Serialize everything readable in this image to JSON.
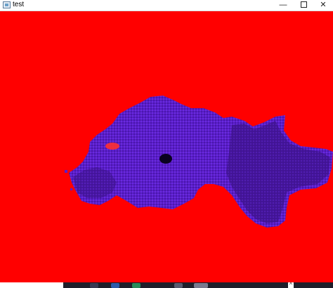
{
  "window": {
    "title": "test",
    "icon": "app-window-icon",
    "controls": {
      "minimize": "—",
      "close": "✕"
    }
  },
  "scene": {
    "background_color": "#ff0000",
    "terrain_color": "#5a1ec8",
    "terrain_shadow_color": "#3c0f8c",
    "terrain_highlight_color": "#7a3cff",
    "hole_color": "#0a0220"
  },
  "taskbar": {
    "background_color": "#1f1f2a",
    "overflow_arrow": "^"
  }
}
